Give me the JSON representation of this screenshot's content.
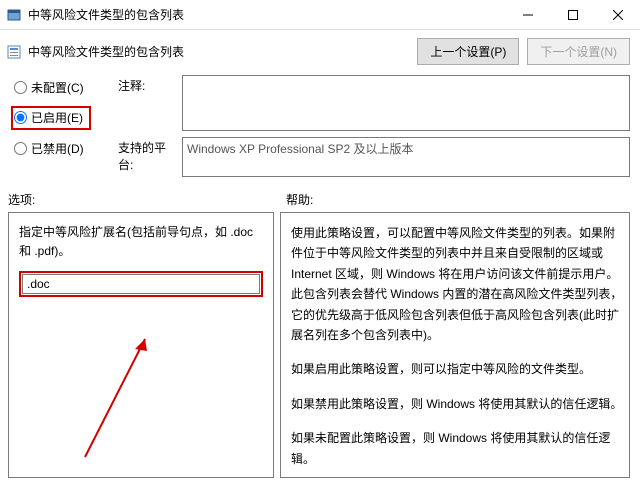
{
  "window": {
    "title": "中等风险文件类型的包含列表"
  },
  "subheader": {
    "title": "中等风险文件类型的包含列表",
    "prev_button": "上一个设置(P)",
    "next_button": "下一个设置(N)"
  },
  "radios": {
    "not_configured": "未配置(C)",
    "enabled": "已启用(E)",
    "disabled": "已禁用(D)"
  },
  "fields": {
    "comment_label": "注释:",
    "comment_value": "",
    "platform_label": "支持的平台:",
    "platform_value": "Windows XP Professional SP2 及以上版本"
  },
  "section_labels": {
    "options": "选项:",
    "help": "帮助:"
  },
  "options_panel": {
    "instruction": "指定中等风险扩展名(包括前导句点，如 .doc 和 .pdf)。",
    "ext_value": ".doc"
  },
  "help_panel": {
    "p1": "使用此策略设置，可以配置中等风险文件类型的列表。如果附件位于中等风险文件类型的列表中并且来自受限制的区域或 Internet 区域，则 Windows 将在用户访问该文件前提示用户。此包含列表会替代 Windows 内置的潜在高风险文件类型列表，它的优先级高于低风险包含列表但低于高风险包含列表(此时扩展名列在多个包含列表中)。",
    "p2": "如果启用此策略设置，则可以指定中等风险的文件类型。",
    "p3": "如果禁用此策略设置，则 Windows 将使用其默认的信任逻辑。",
    "p4": "如果未配置此策略设置，则 Windows 将使用其默认的信任逻辑。"
  }
}
